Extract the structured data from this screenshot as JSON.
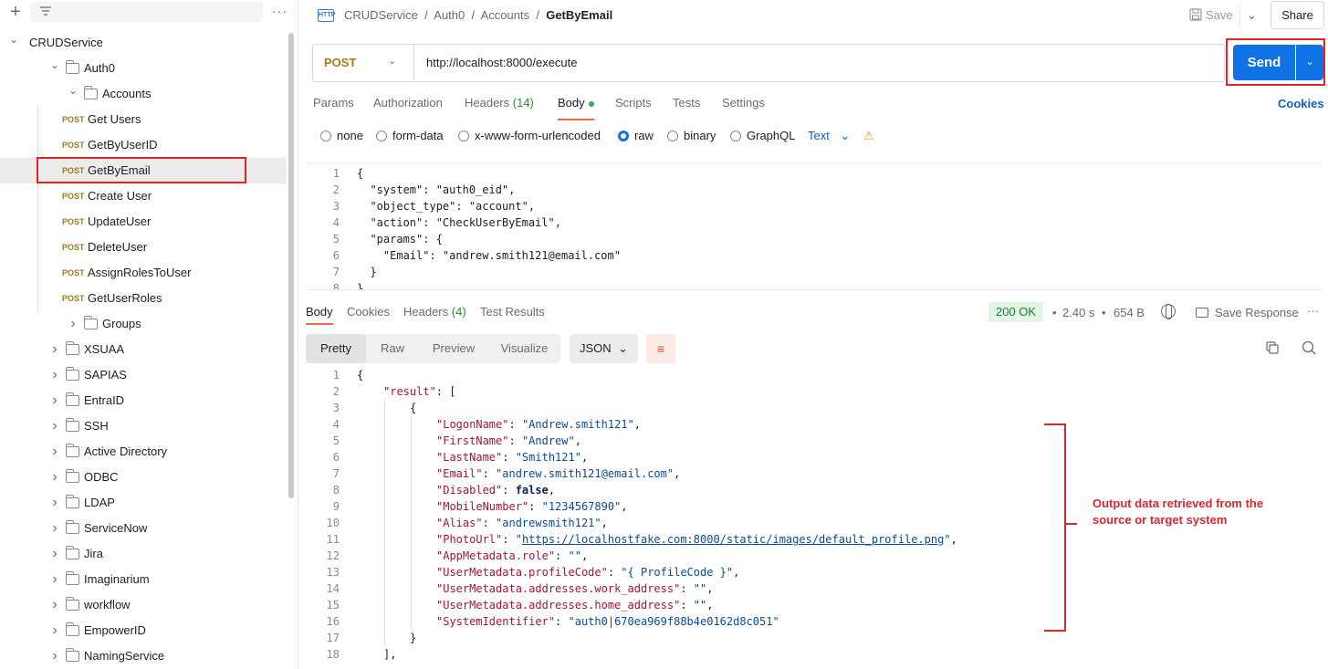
{
  "sidebar": {
    "more_label": "···",
    "tree": [
      {
        "label": "CRUDService",
        "level": 0,
        "type": "root",
        "expanded": true
      },
      {
        "label": "Auth0",
        "level": 1,
        "type": "folder",
        "expanded": true
      },
      {
        "label": "Accounts",
        "level": 2,
        "type": "folder",
        "expanded": true
      },
      {
        "label": "Get Users",
        "level": 3,
        "type": "request",
        "method": "POST"
      },
      {
        "label": "GetByUserID",
        "level": 3,
        "type": "request",
        "method": "POST"
      },
      {
        "label": "GetByEmail",
        "level": 3,
        "type": "request",
        "method": "POST",
        "selected": true
      },
      {
        "label": "Create User",
        "level": 3,
        "type": "request",
        "method": "POST"
      },
      {
        "label": "UpdateUser",
        "level": 3,
        "type": "request",
        "method": "POST"
      },
      {
        "label": "DeleteUser",
        "level": 3,
        "type": "request",
        "method": "POST"
      },
      {
        "label": "AssignRolesToUser",
        "level": 3,
        "type": "request",
        "method": "POST"
      },
      {
        "label": "GetUserRoles",
        "level": 3,
        "type": "request",
        "method": "POST"
      },
      {
        "label": "Groups",
        "level": 2,
        "type": "folder",
        "expanded": false
      },
      {
        "label": "XSUAA",
        "level": 1,
        "type": "folder",
        "expanded": false
      },
      {
        "label": "SAPIAS",
        "level": 1,
        "type": "folder",
        "expanded": false
      },
      {
        "label": "EntraID",
        "level": 1,
        "type": "folder",
        "expanded": false
      },
      {
        "label": "SSH",
        "level": 1,
        "type": "folder",
        "expanded": false
      },
      {
        "label": "Active Directory",
        "level": 1,
        "type": "folder",
        "expanded": false
      },
      {
        "label": "ODBC",
        "level": 1,
        "type": "folder",
        "expanded": false
      },
      {
        "label": "LDAP",
        "level": 1,
        "type": "folder",
        "expanded": false
      },
      {
        "label": "ServiceNow",
        "level": 1,
        "type": "folder",
        "expanded": false
      },
      {
        "label": "Jira",
        "level": 1,
        "type": "folder",
        "expanded": false
      },
      {
        "label": "Imaginarium",
        "level": 1,
        "type": "folder",
        "expanded": false
      },
      {
        "label": "workflow",
        "level": 1,
        "type": "folder",
        "expanded": false
      },
      {
        "label": "EmpowerID",
        "level": 1,
        "type": "folder",
        "expanded": false
      },
      {
        "label": "NamingService",
        "level": 1,
        "type": "folder",
        "expanded": false
      }
    ]
  },
  "header": {
    "breadcrumb": [
      "CRUDService",
      "Auth0",
      "Accounts"
    ],
    "current": "GetByEmail",
    "http_icon_label": "HTTP",
    "save_label": "Save",
    "share_label": "Share"
  },
  "request": {
    "method": "POST",
    "url": "http://localhost:8000/execute",
    "send_label": "Send",
    "tabs": [
      {
        "label": "Params"
      },
      {
        "label": "Authorization"
      },
      {
        "label": "Headers",
        "count": "(14)"
      },
      {
        "label": "Body",
        "active": true
      },
      {
        "label": "Scripts"
      },
      {
        "label": "Tests"
      },
      {
        "label": "Settings"
      }
    ],
    "cookies_label": "Cookies",
    "body_types": [
      {
        "label": "none"
      },
      {
        "label": "form-data"
      },
      {
        "label": "x-www-form-urlencoded"
      },
      {
        "label": "raw",
        "selected": true
      },
      {
        "label": "binary"
      },
      {
        "label": "GraphQL"
      }
    ],
    "raw_format": "Text",
    "body_lines": [
      "{",
      "  \"system\": \"auth0_eid\",",
      "  \"object_type\": \"account\",",
      "  \"action\": \"CheckUserByEmail\",",
      "  \"params\": {",
      "    \"Email\": \"andrew.smith121@email.com\"",
      "  }",
      "}"
    ]
  },
  "response": {
    "tabs": [
      {
        "label": "Body",
        "active": true
      },
      {
        "label": "Cookies"
      },
      {
        "label": "Headers",
        "count": "(4)"
      },
      {
        "label": "Test Results"
      }
    ],
    "status": "200 OK",
    "time": "2.40 s",
    "size": "654 B",
    "save_response_label": "Save Response",
    "view_modes": [
      "Pretty",
      "Raw",
      "Preview",
      "Visualize"
    ],
    "active_view": "Pretty",
    "format": "JSON",
    "json_open": "{",
    "result_key": "\"result\"",
    "fields": [
      {
        "key": "\"LogonName\"",
        "value": "\"Andrew.smith121\""
      },
      {
        "key": "\"FirstName\"",
        "value": "\"Andrew\""
      },
      {
        "key": "\"LastName\"",
        "value": "\"Smith121\""
      },
      {
        "key": "\"Email\"",
        "value": "\"andrew.smith121@email.com\""
      },
      {
        "key": "\"Disabled\"",
        "value": "false",
        "bool": true
      },
      {
        "key": "\"MobileNumber\"",
        "value": "\"1234567890\""
      },
      {
        "key": "\"Alias\"",
        "value": "\"andrewsmith121\""
      },
      {
        "key": "\"PhotoUrl\"",
        "value": "https://localhostfake.com:8000/static/images/default_profile.png",
        "link": true
      },
      {
        "key": "\"AppMetadata.role\"",
        "value": "\"\""
      },
      {
        "key": "\"UserMetadata.profileCode\"",
        "value": "\"{ ProfileCode }\""
      },
      {
        "key": "\"UserMetadata.addresses.work_address\"",
        "value": "\"\""
      },
      {
        "key": "\"UserMetadata.addresses.home_address\"",
        "value": "\"\""
      },
      {
        "key": "\"SystemIdentifier\"",
        "value": "\"auth0|670ea969f88b4e0162d8c051\"",
        "last": true
      }
    ]
  },
  "annotation": {
    "text": "Output data retrieved from the source or target system",
    "color": "#d9262f"
  },
  "colors": {
    "accent": "#0f72e5",
    "post_method": "#a6791a",
    "tab_underline": "#f26b3a",
    "status_ok": "#1e7b34"
  }
}
